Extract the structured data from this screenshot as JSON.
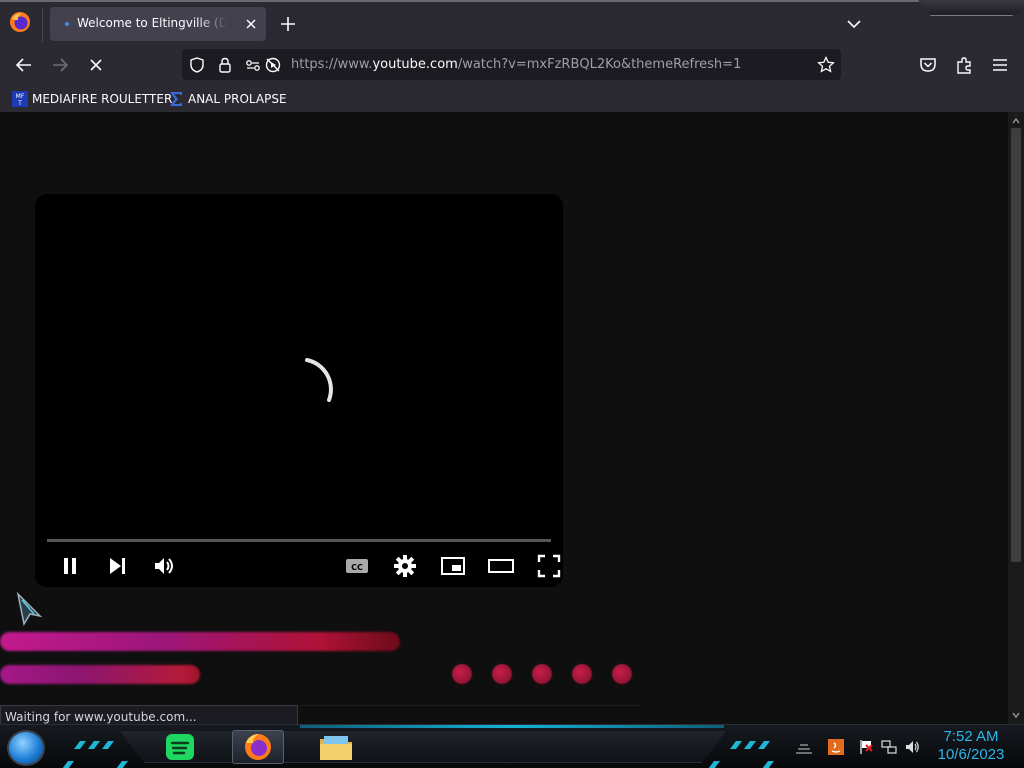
{
  "browser": {
    "tab": {
      "title": "Welcome to Eltingville (DVD RIP)",
      "close_label": "Close tab"
    },
    "new_tab_label": "Open a new tab",
    "list_tabs_label": "List all tabs",
    "url": {
      "prefix": "https://www.",
      "host": "youtube.com",
      "path": "/watch?v=mxFzRBQL2Ko&themeRefresh=1"
    },
    "bookmarks": [
      {
        "label": "MEDIAFIRE ROULETTER",
        "icon": "mediafire-icon"
      },
      {
        "label": "ANAL PROLAPSE",
        "icon": "sigma-icon"
      }
    ],
    "status_text": "Waiting for www.youtube.com..."
  },
  "player": {
    "state": "loading",
    "controls": [
      "pause-icon",
      "next-icon",
      "volume-icon",
      "cc-icon",
      "settings-icon",
      "miniplayer-icon",
      "theater-icon",
      "fullscreen-icon"
    ],
    "cc_label": "CC"
  },
  "taskbar": {
    "apps": [
      "spotify-icon",
      "firefox-icon",
      "file-explorer-icon"
    ],
    "time": "7:52 AM",
    "date": "10/6/2023"
  },
  "colors": {
    "chrome": "#2b2a33",
    "urlbar": "#1c1b22",
    "page_bg": "#0f0f0f",
    "clock": "#2ab6e8",
    "accent_glow": "#13b3d8"
  }
}
